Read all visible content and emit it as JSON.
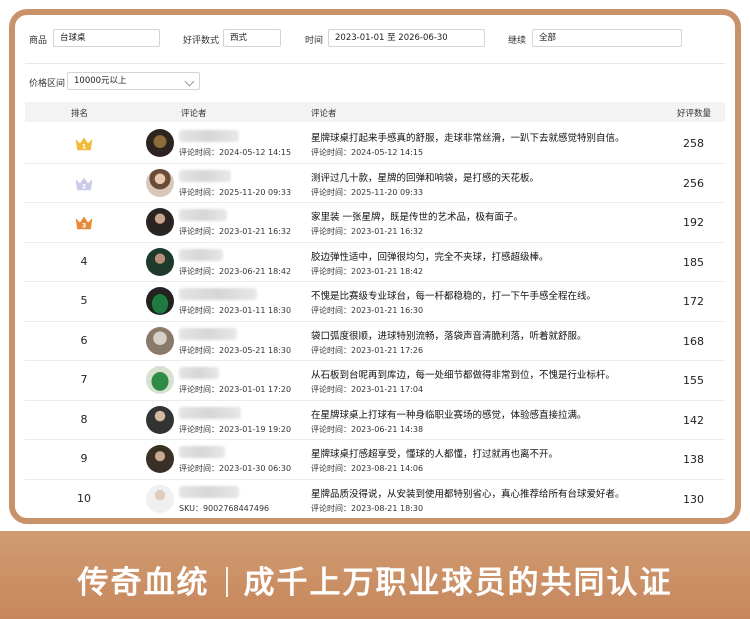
{
  "filters": {
    "product_label": "商品",
    "product_value": "台球桌",
    "rating_label": "好评数式",
    "rating_value": "西式",
    "time_label": "时间",
    "time_value": "2023-01-01 至 2026-06-30",
    "cont_label": "继续",
    "cont_value": "全部",
    "price_label": "价格区间",
    "price_value": "10000元以上"
  },
  "table": {
    "headers": {
      "rank": "排名",
      "reviewer": "评论者",
      "comment": "评论者",
      "count": "好评数量"
    },
    "rows": [
      {
        "rank": "1",
        "crown": "gold",
        "reviewer_time": "评论时间：2024-05-12 14:15",
        "comment": "星牌球桌打起来手感真的舒服，走球非常丝滑，一趴下去就感觉特别自信。",
        "comment_time": "评论时间：2024-05-12 14:15",
        "count": "258"
      },
      {
        "rank": "2",
        "crown": "silver",
        "reviewer_time": "评论时间：2025-11-20 09:33",
        "comment": "测评过几十款，星牌的回弹和响袋，是打感的天花板。",
        "comment_time": "评论时间：2025-11-20 09:33",
        "count": "256"
      },
      {
        "rank": "3",
        "crown": "bronze",
        "reviewer_time": "评论时间：2023-01-21 16:32",
        "comment": "家里装 一张星牌，既是传世的艺术品，极有面子。",
        "comment_time": "评论时间：2023-01-21 16:32",
        "count": "192"
      },
      {
        "rank": "4",
        "crown": "",
        "reviewer_time": "评论时间：2023-06-21 18:42",
        "comment": "胶边弹性适中，回弹很均匀，完全不夹球，打感超级棒。",
        "comment_time": "评论时间：2023-01-21 18:42",
        "count": "185"
      },
      {
        "rank": "5",
        "crown": "",
        "reviewer_time": "评论时间：2023-01-11 18:30",
        "comment": "不愧是比赛级专业球台，每一杆都稳稳的，打一下午手感全程在线。",
        "comment_time": "评论时间：2023-01-21 16:30",
        "count": "172"
      },
      {
        "rank": "6",
        "crown": "",
        "reviewer_time": "评论时间：2023-05-21 18:30",
        "comment": "袋口弧度很顺，进球特别流畅，落袋声音清脆利落，听着就舒服。",
        "comment_time": "评论时间：2023-01-21 17:26",
        "count": "168"
      },
      {
        "rank": "7",
        "crown": "",
        "reviewer_time": "评论时间：2023-01-01 17:20",
        "comment": "从石板到台呢再到库边，每一处细节都做得非常到位，不愧是行业标杆。",
        "comment_time": "评论时间：2023-01-21 17:04",
        "count": "155"
      },
      {
        "rank": "8",
        "crown": "",
        "reviewer_time": "评论时间：2023-01-19 19:20",
        "comment": "在星牌球桌上打球有一种身临职业赛场的感觉，体验感直接拉满。",
        "comment_time": "评论时间：2023-06-21 14:38",
        "count": "142"
      },
      {
        "rank": "9",
        "crown": "",
        "reviewer_time": "评论时间：2023-01-30 06:30",
        "comment": "星牌球桌打感超享受，懂球的人都懂，打过就再也离不开。",
        "comment_time": "评论时间：2023-08-21 14:06",
        "count": "138"
      },
      {
        "rank": "10",
        "crown": "",
        "reviewer_time": "SKU：9002768447496",
        "comment": "星牌品质没得说，从安装到使用都特别省心，真心推荐给所有台球爱好者。",
        "comment_time": "评论时间：2023-08-21 18:30",
        "count": "130"
      }
    ]
  },
  "banner": {
    "left": "传奇血统",
    "right": "成千上万职业球员的共同认证"
  },
  "colors": {
    "frame": "#c9926a",
    "banner": "#c7875c",
    "gold": "#f2b93a",
    "silver": "#c9cbe6",
    "bronze": "#e58a3c"
  }
}
